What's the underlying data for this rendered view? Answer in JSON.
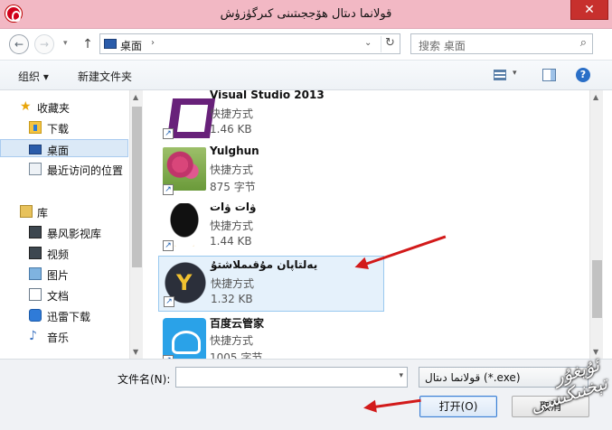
{
  "window": {
    "title": "قولانما دىتال ھۆججىتىنى كىرگۈزۈش",
    "close_glyph": "✕"
  },
  "address": {
    "back_glyph": "←",
    "forward_glyph": "→",
    "up_glyph": "↑",
    "crumb": "桌面",
    "separator": "›",
    "refresh_glyph": "↻",
    "search_placeholder": "搜索 桌面"
  },
  "toolbar": {
    "organize_label": "组织 ▾",
    "new_folder_label": "新建文件夹",
    "help_glyph": "?"
  },
  "nav": {
    "favorites": [
      {
        "label": "收藏夹",
        "icon": "star-icon"
      },
      {
        "label": "下载",
        "icon": "downloads-folder-icon"
      },
      {
        "label": "桌面",
        "icon": "desktop-icon",
        "selected": true
      },
      {
        "label": "最近访问的位置",
        "icon": "recent-places-icon"
      }
    ],
    "libraries": [
      {
        "label": "库",
        "icon": "libraries-icon"
      },
      {
        "label": "暴风影视库",
        "icon": "baofeng-library-icon"
      },
      {
        "label": "视频",
        "icon": "videos-icon"
      },
      {
        "label": "图片",
        "icon": "pictures-icon"
      },
      {
        "label": "文档",
        "icon": "documents-icon"
      },
      {
        "label": "迅雷下载",
        "icon": "xunlei-download-icon"
      },
      {
        "label": "音乐",
        "icon": "music-icon"
      }
    ]
  },
  "files": [
    {
      "name": "Visual Studio 2013",
      "type": "快捷方式",
      "size": "1.46 KB",
      "icon": "visual-studio-icon"
    },
    {
      "name": "Yulghun",
      "type": "快捷方式",
      "size": "875 字节",
      "icon": "flower-image-icon"
    },
    {
      "name": "ۋات ۋات",
      "type": "快捷方式",
      "size": "1.44 KB",
      "icon": "qq-penguin-icon"
    },
    {
      "name": "يەلتاپان مۇقىملاشتۇ",
      "type": "快捷方式",
      "size": "1.32 KB",
      "icon": "y-shield-icon",
      "selected": true
    },
    {
      "name": "百度云管家",
      "type": "快捷方式",
      "size": "1005 字节",
      "icon": "baidu-cloud-icon"
    }
  ],
  "bottom": {
    "filename_label": "文件名(N):",
    "filename_value": "",
    "filter_value": "قولانما دىتال (*.exe)",
    "open_label": "打开(O)",
    "cancel_label": "取消",
    "watermark_text": "ئۇيغۇر تېخنىكىسى"
  },
  "colors": {
    "titlebar": "#f2b8c4",
    "close_button": "#c7302d",
    "selection": "#e5f1fb",
    "arrow": "#d21a1a"
  }
}
